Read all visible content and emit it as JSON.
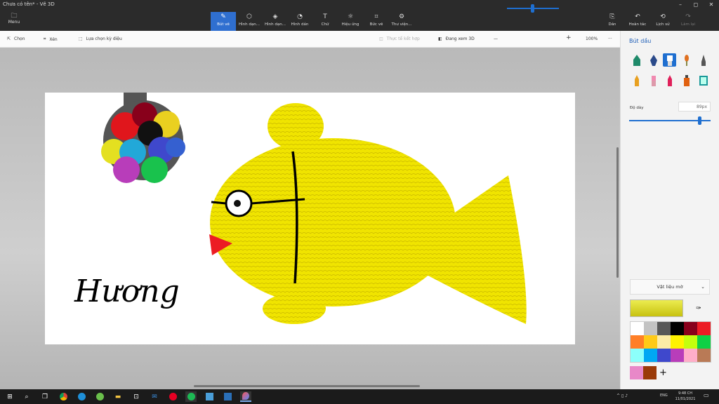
{
  "window": {
    "title": "Chưa có tên* - Vẽ 3D",
    "controls": [
      "–",
      "◻",
      "✕"
    ]
  },
  "menu": {
    "label": "Menu"
  },
  "toolbar": {
    "items": [
      {
        "label": "Bút vẽ",
        "icon": "brush-icon"
      },
      {
        "label": "Hình dạn...",
        "icon": "shapes-2d-icon"
      },
      {
        "label": "Hình dạn...",
        "icon": "shapes-3d-icon"
      },
      {
        "label": "Hình dán",
        "icon": "sticker-icon"
      },
      {
        "label": "Chữ",
        "icon": "text-icon"
      },
      {
        "label": "Hiệu ứng",
        "icon": "effects-icon"
      },
      {
        "label": "Bức vẽ",
        "icon": "canvas-icon"
      },
      {
        "label": "Thư viện...",
        "icon": "library-icon"
      }
    ],
    "right": [
      {
        "label": "Dán",
        "icon": "paste-icon"
      },
      {
        "label": "Hoàn tác",
        "icon": "undo-icon"
      },
      {
        "label": "Lịch sử",
        "icon": "history-icon"
      },
      {
        "label": "Làm lại",
        "icon": "redo-icon"
      }
    ]
  },
  "options": {
    "select": "Chọn",
    "crop": "Xén",
    "magic": "Lựa chọn kỳ diệu",
    "mixed_reality": "Thực tế kết hợp",
    "view3d": "Đang xem 3D",
    "zoom": "100%",
    "more": "···",
    "minus": "—",
    "plus": "+"
  },
  "canvas": {
    "signature": "Hương"
  },
  "panel": {
    "title": "Bút dầu",
    "thickness_label": "Độ dày",
    "thickness_value": "89px",
    "material": "Vật liệu mờ",
    "palette": [
      "#ffffff",
      "#c3c3c3",
      "#585858",
      "#000000",
      "#88001b",
      "#ec1c24",
      "#ff7f27",
      "#ffca18",
      "#fdeca6",
      "#fff200",
      "#c4ff0e",
      "#0ed145",
      "#8cfffb",
      "#00a8f3",
      "#3f48cc",
      "#b83dba",
      "#ffaec8",
      "#b97a56"
    ],
    "extra": [
      "#e888c8",
      "#9a3a08"
    ],
    "current_color": "#e5e23a"
  },
  "taskbar": {
    "time": "9:48 CH",
    "date": "11/01/2021",
    "lang": "ENG"
  }
}
